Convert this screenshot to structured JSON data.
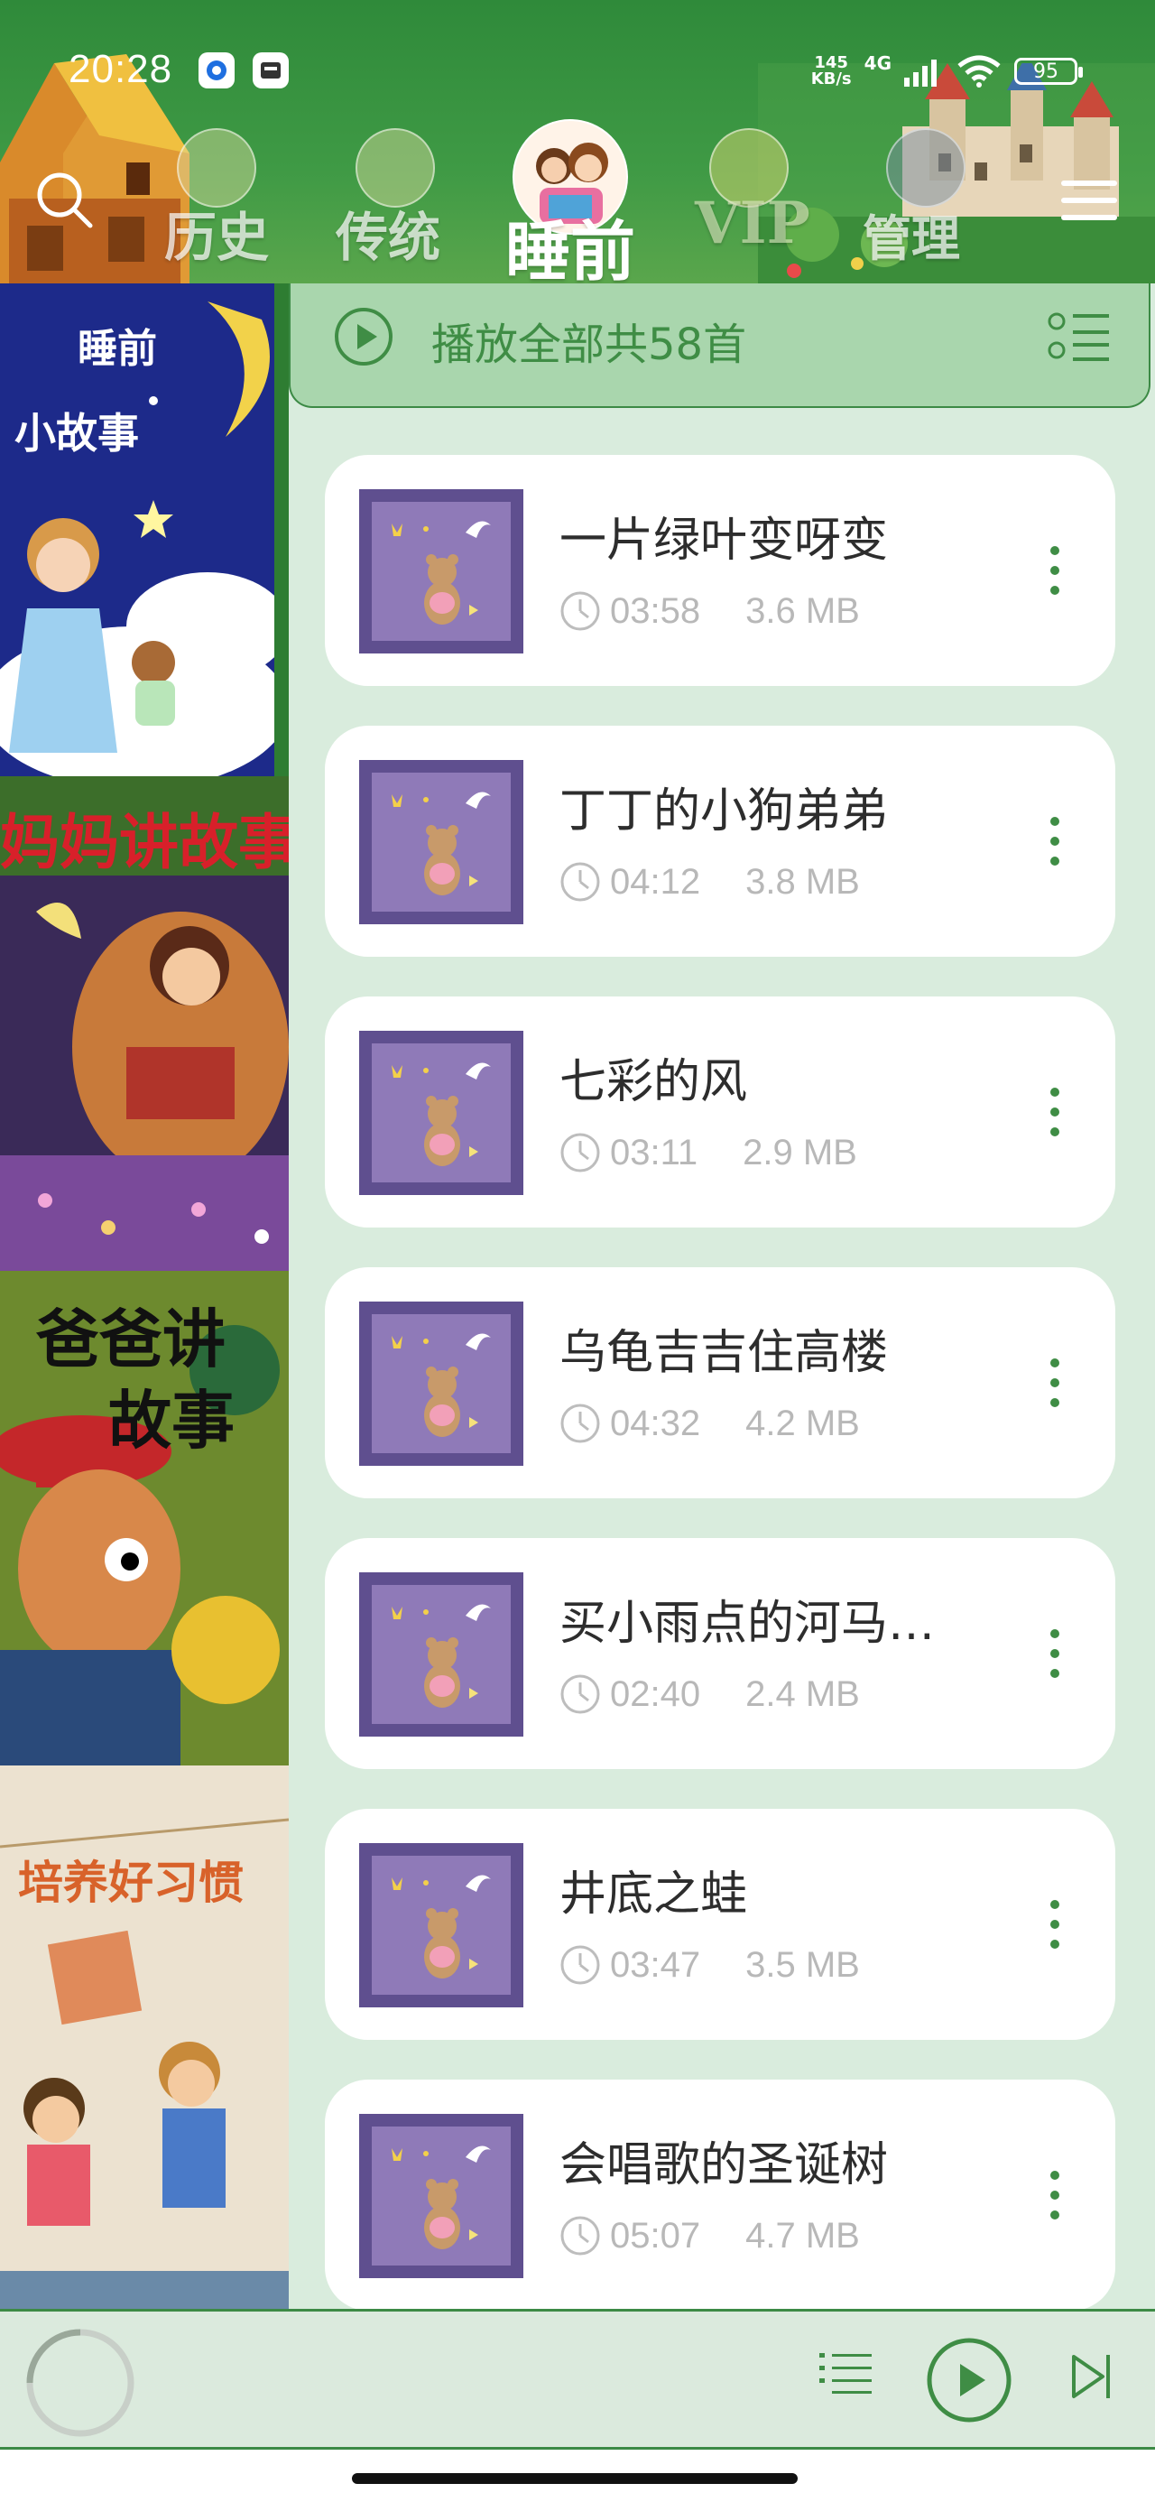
{
  "status_bar": {
    "time": "20:28",
    "net_speed_value": "145",
    "net_speed_unit": "KB/s",
    "network": "4G",
    "battery": "95",
    "icons": [
      "app-notification-icon",
      "app-notification-icon",
      "signal-icon",
      "wifi-icon",
      "battery-icon"
    ]
  },
  "header": {
    "tabs": [
      {
        "label": "历史",
        "active": false,
        "icon": "history-icon"
      },
      {
        "label": "传统",
        "active": false,
        "icon": "traditional-icon"
      },
      {
        "label": "睡前",
        "active": true,
        "icon": "bedtime-avatar-icon"
      },
      {
        "label": "VIP",
        "active": false,
        "icon": "vip-icon"
      },
      {
        "label": "管理",
        "active": false,
        "icon": "manage-icon"
      }
    ],
    "search_icon": "search-icon",
    "menu_icon": "menu-icon"
  },
  "covers": [
    {
      "title_line1": "睡前",
      "title_line2": "小故事"
    },
    {
      "title": "妈妈讲故事"
    },
    {
      "title_line1": "爸爸讲",
      "title_line2": "故事"
    },
    {
      "title_line1": "培养好习惯"
    }
  ],
  "playall": {
    "label": "播放全部共58首"
  },
  "songs": [
    {
      "title": "一片绿叶变呀变",
      "duration": "03:58",
      "size": "3.6 MB"
    },
    {
      "title": "丁丁的小狗弟弟",
      "duration": "04:12",
      "size": "3.8 MB"
    },
    {
      "title": "七彩的风",
      "duration": "03:11",
      "size": "2.9 MB"
    },
    {
      "title": "乌龟吉吉住高楼",
      "duration": "04:32",
      "size": "4.2 MB"
    },
    {
      "title": "买小雨点的河马…",
      "duration": "02:40",
      "size": "2.4 MB"
    },
    {
      "title": "井底之蛙",
      "duration": "03:47",
      "size": "3.5 MB"
    },
    {
      "title": "会唱歌的圣诞树",
      "duration": "05:07",
      "size": "4.7 MB"
    }
  ],
  "player": {
    "icons": [
      "loading-spinner-icon",
      "playlist-icon",
      "play-icon",
      "next-track-icon"
    ]
  },
  "colors": {
    "header_green": "#2f8a3a",
    "accent_green": "#3f8d45",
    "panel_bg": "#d9ecdd",
    "playall_bg": "#a9d6ad",
    "thumb_purple": "#5f4f8f"
  }
}
